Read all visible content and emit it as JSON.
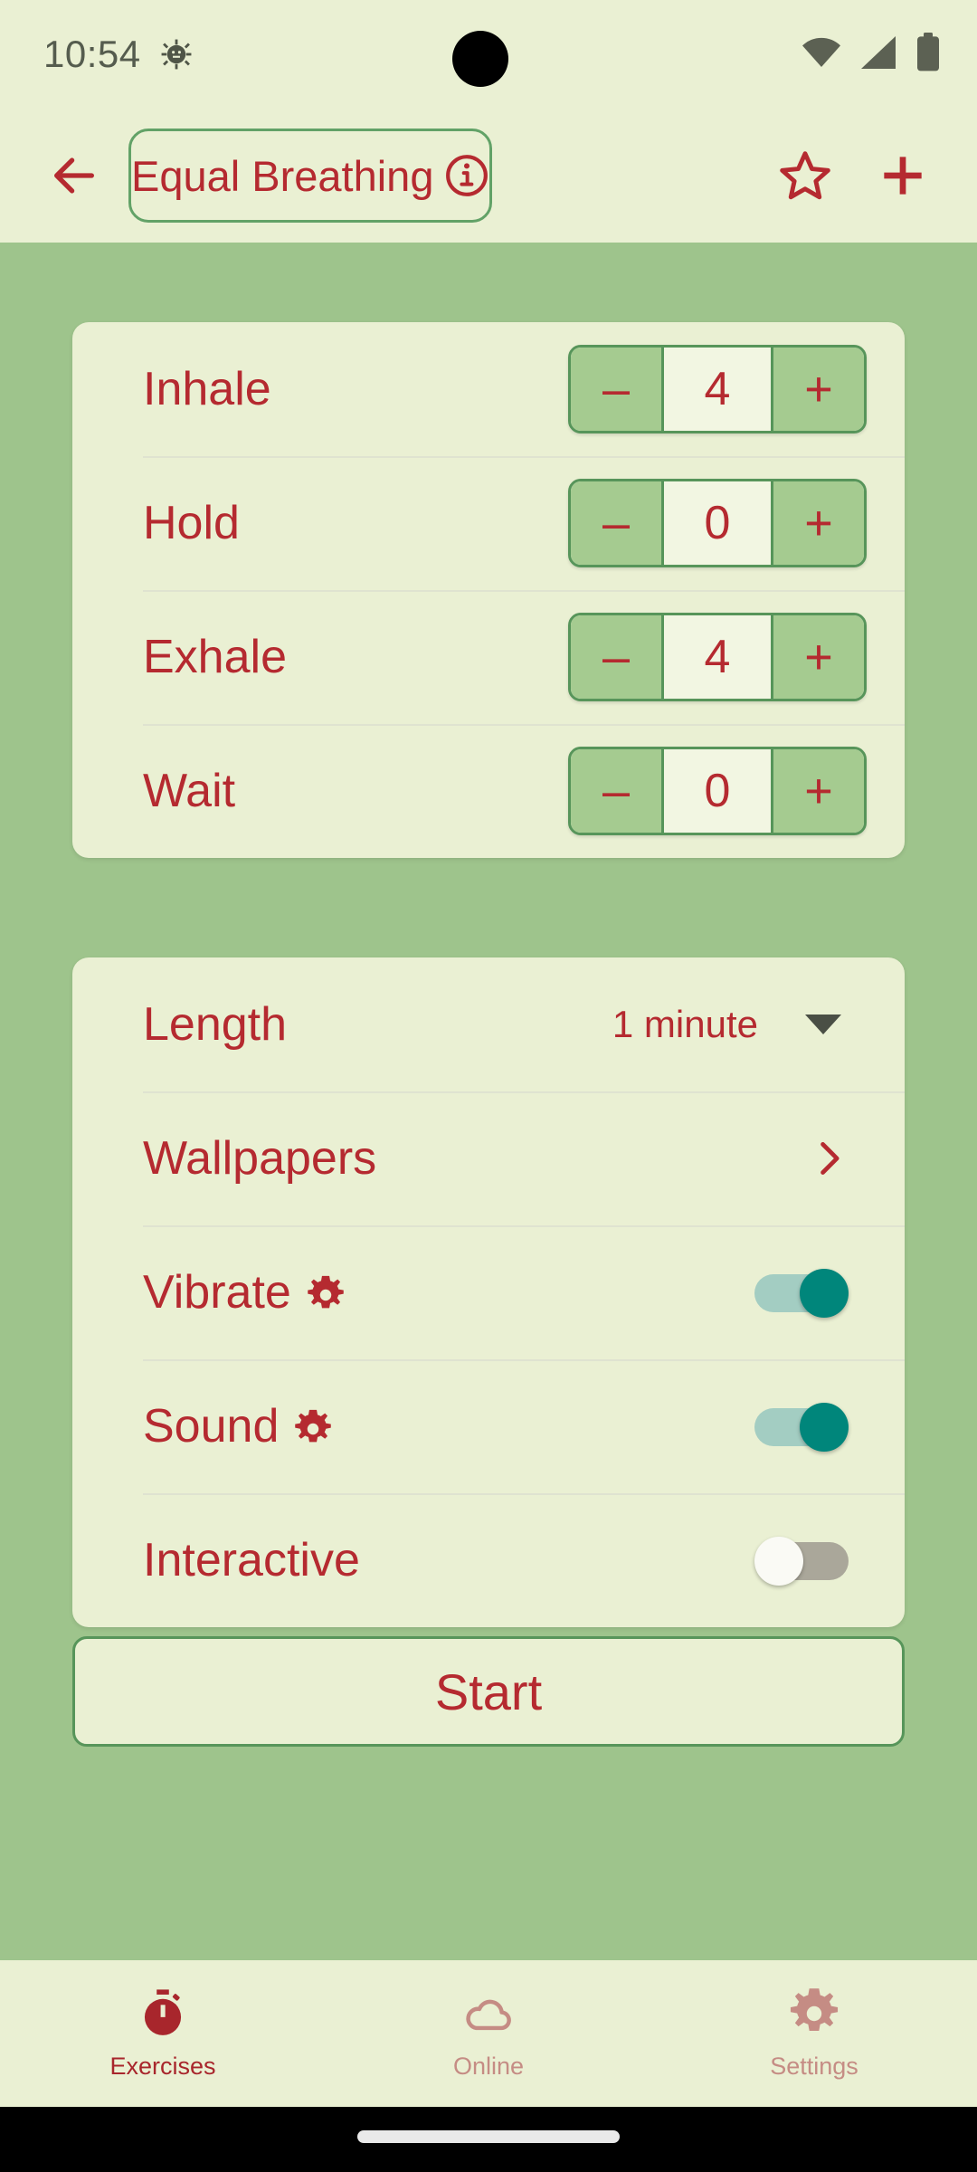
{
  "status_bar": {
    "clock": "10:54",
    "icons": [
      "android-gear-icon",
      "wifi-icon",
      "signal-icon",
      "battery-icon"
    ]
  },
  "app_bar": {
    "back_icon": "back-arrow-icon",
    "title": "Equal Breathing",
    "info_icon": "info-circle-icon",
    "favorite_icon": "star-outline-icon",
    "add_icon": "plus-icon"
  },
  "phases_card": {
    "rows": [
      {
        "label": "Inhale",
        "value": "4",
        "minus": "–",
        "plus": "+"
      },
      {
        "label": "Hold",
        "value": "0",
        "minus": "–",
        "plus": "+"
      },
      {
        "label": "Exhale",
        "value": "4",
        "minus": "–",
        "plus": "+"
      },
      {
        "label": "Wait",
        "value": "0",
        "minus": "–",
        "plus": "+"
      }
    ]
  },
  "settings_card": {
    "length": {
      "label": "Length",
      "value": "1 minute",
      "control": "dropdown"
    },
    "wallpapers": {
      "label": "Wallpapers",
      "control": "chevron-right"
    },
    "vibrate": {
      "label": "Vibrate",
      "gear": "gear-icon",
      "state": "on"
    },
    "sound": {
      "label": "Sound",
      "gear": "gear-icon",
      "state": "on"
    },
    "interactive": {
      "label": "Interactive",
      "state": "off"
    }
  },
  "start_button": {
    "label": "Start"
  },
  "bottom_nav": {
    "items": [
      {
        "label": "Exercises",
        "icon": "stopwatch-icon",
        "active": true
      },
      {
        "label": "Online",
        "icon": "cloud-icon",
        "active": false
      },
      {
        "label": "Settings",
        "icon": "gear-icon",
        "active": false
      }
    ]
  },
  "colors": {
    "background": "#9ec48c",
    "card": "#eaf0d3",
    "accent_red": "#b52a30",
    "border_green": "#57955a",
    "stepper_button": "#a5cb90",
    "toggle_on_thumb": "#00867b",
    "toggle_on_track": "#a3cdc2",
    "toggle_off_thumb": "#fafaf5",
    "toggle_off_track": "#aaa79a",
    "nav_inactive": "#c58c84"
  }
}
